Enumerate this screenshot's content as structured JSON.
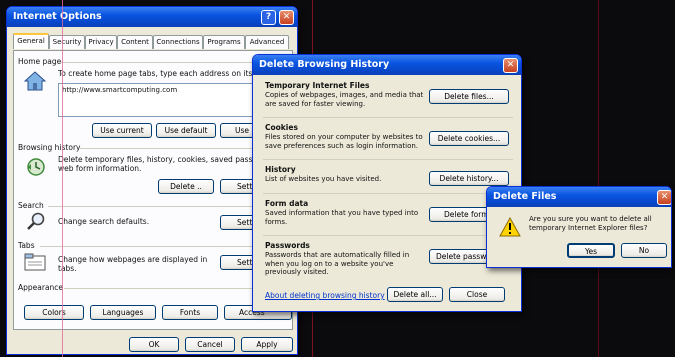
{
  "internet_options": {
    "title": "Internet Options",
    "tabs": [
      "General",
      "Security",
      "Privacy",
      "Content",
      "Connections",
      "Programs",
      "Advanced"
    ],
    "home_page": {
      "group_label": "Home page",
      "description": "To create home page tabs, type each address on its own",
      "url_value": "http://www.smartcomputing.com",
      "use_current": "Use current",
      "use_default": "Use default",
      "use_blank": "Use bla"
    },
    "browsing_history": {
      "group_label": "Browsing history",
      "description": "Delete temporary files, history, cookies, saved passwor and web form information.",
      "delete_label": "Delete ..",
      "settings_label": "Settin"
    },
    "search": {
      "group_label": "Search",
      "description": "Change search defaults.",
      "settings_label": "Settin"
    },
    "tabs_group": {
      "group_label": "Tabs",
      "description": "Change how webpages are displayed in tabs.",
      "settings_label": "Settin"
    },
    "appearance": {
      "group_label": "Appearance",
      "colors": "Colors",
      "languages": "Languages",
      "fonts": "Fonts",
      "accessibility": "Access"
    },
    "ok": "OK",
    "cancel": "Cancel",
    "apply": "Apply"
  },
  "delete_history": {
    "title": "Delete Browsing History",
    "sections": [
      {
        "heading": "Temporary Internet Files",
        "text": "Copies of webpages, images, and media that are saved for faster viewing.",
        "button": "Delete files..."
      },
      {
        "heading": "Cookies",
        "text": "Files stored on your computer by websites to save preferences such as login information.",
        "button": "Delete cookies..."
      },
      {
        "heading": "History",
        "text": "List of websites you have visited.",
        "button": "Delete history..."
      },
      {
        "heading": "Form data",
        "text": "Saved information that you have typed into forms.",
        "button": "Delete forms"
      },
      {
        "heading": "Passwords",
        "text": "Passwords that are automatically filled in when you log on to a website you've previously visited.",
        "button": "Delete passwor"
      }
    ],
    "about_link": "About deleting browsing history",
    "delete_all": "Delete all...",
    "close": "Close"
  },
  "delete_files": {
    "title": "Delete Files",
    "message": "Are you sure you want to delete all temporary Internet Explorer files?",
    "yes": "Yes",
    "no": "No"
  },
  "colors": {
    "titlebar": "#0a55e0",
    "dialog_bg": "#ece9d8",
    "link": "#0033cc",
    "warning": "#ffd400"
  }
}
